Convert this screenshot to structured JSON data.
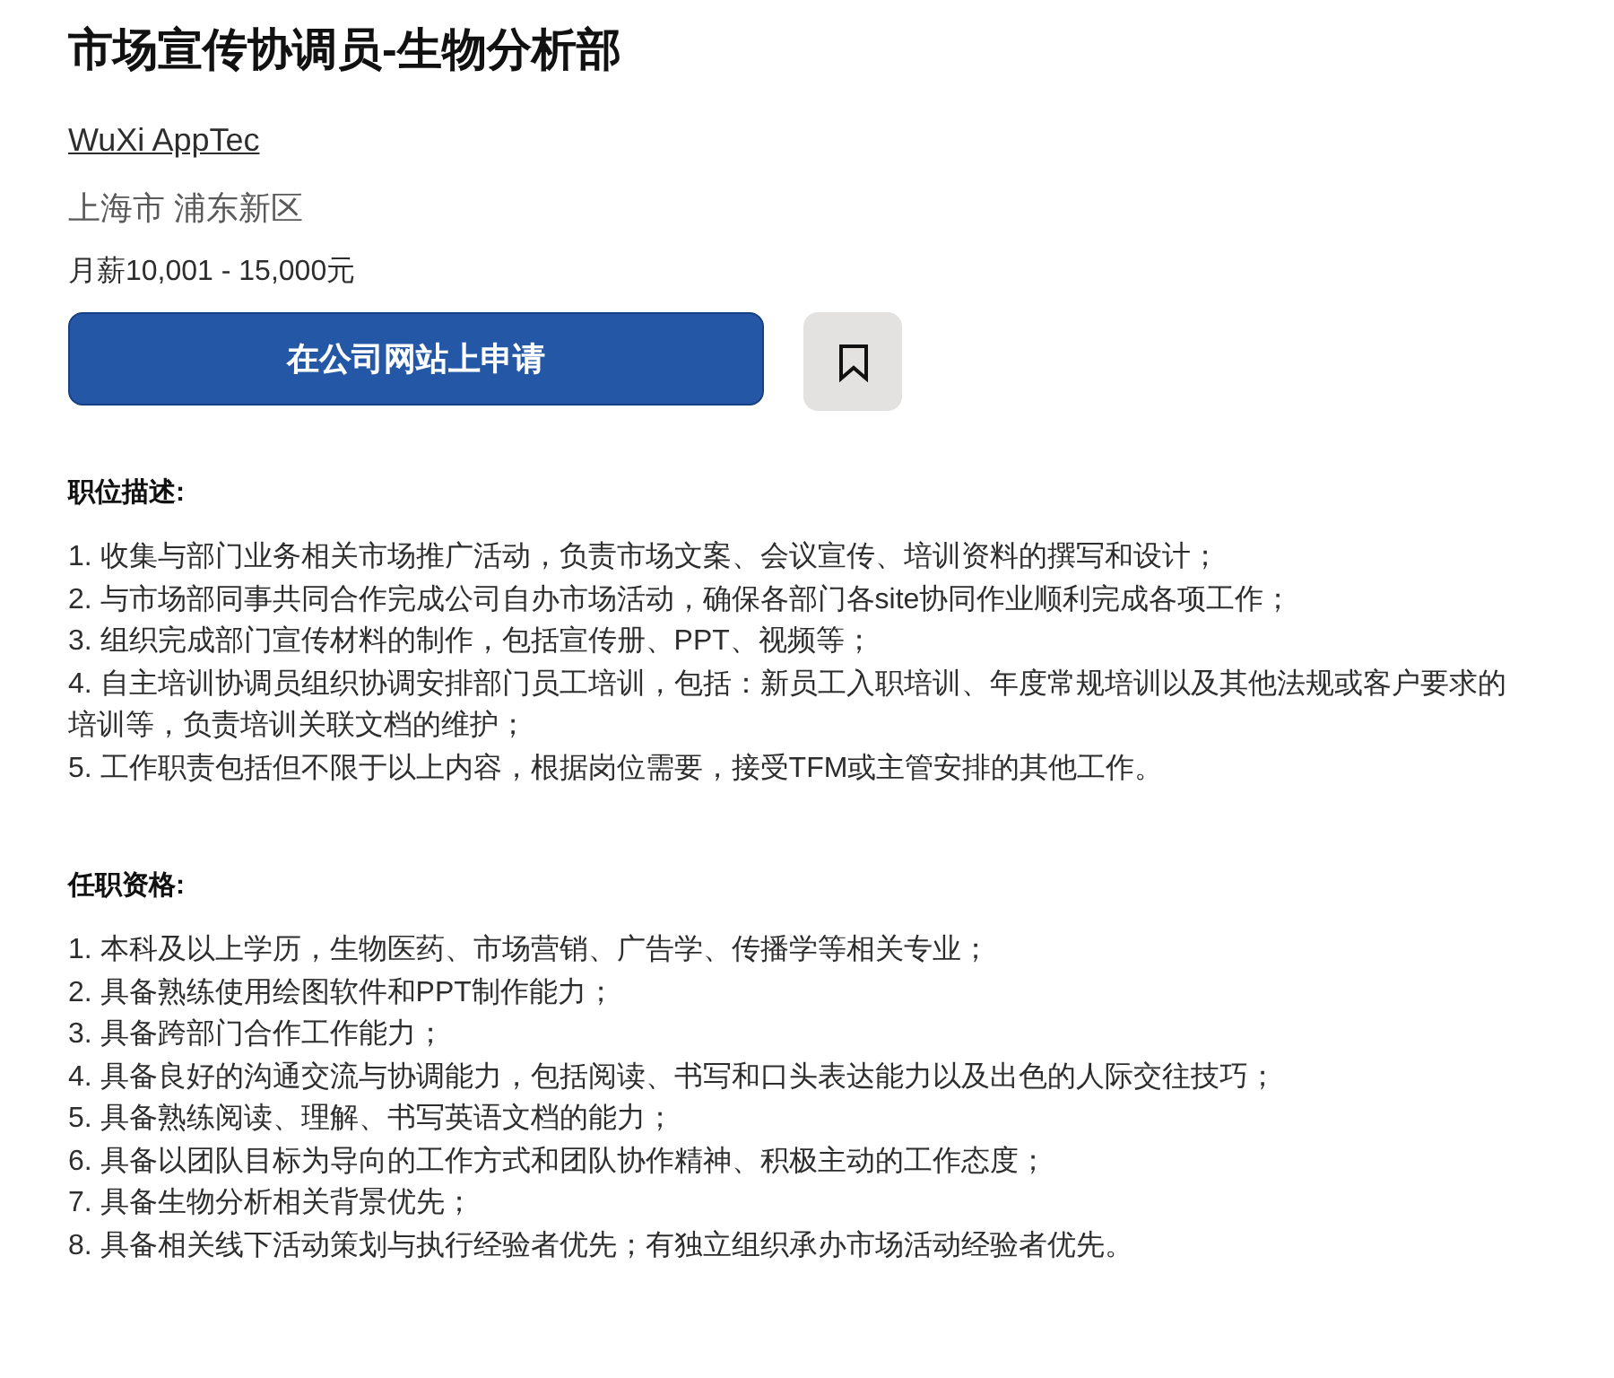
{
  "title": "市场宣传协调员-生物分析部",
  "company": "WuXi AppTec",
  "location": "上海市 浦东新区",
  "salary": "月薪10,001 - 15,000元",
  "apply_button": "在公司网站上申请",
  "sections": [
    {
      "heading": "职位描述:",
      "items": [
        "1. 收集与部门业务相关市场推广活动，负责市场文案、会议宣传、培训资料的撰写和设计；",
        "2. 与市场部同事共同合作完成公司自办市场活动，确保各部门各site协同作业顺利完成各项工作；",
        "3. 组织完成部门宣传材料的制作，包括宣传册、PPT、视频等；",
        "4. 自主培训协调员组织协调安排部门员工培训，包括：新员工入职培训、年度常规培训以及其他法规或客户要求的培训等，负责培训关联文档的维护；",
        "5. 工作职责包括但不限于以上内容，根据岗位需要，接受TFM或主管安排的其他工作。"
      ]
    },
    {
      "heading": "任职资格:",
      "items": [
        "1. 本科及以上学历，生物医药、市场营销、广告学、传播学等相关专业；",
        "2. 具备熟练使用绘图软件和PPT制作能力；",
        "3. 具备跨部门合作工作能力；",
        "4. 具备良好的沟通交流与协调能力，包括阅读、书写和口头表达能力以及出色的人际交往技巧；",
        "5. 具备熟练阅读、理解、书写英语文档的能力；",
        "6. 具备以团队目标为导向的工作方式和团队协作精神、积极主动的工作态度；",
        "7. 具备生物分析相关背景优先；",
        "8. 具备相关线下活动策划与执行经验者优先；有独立组织承办市场活动经验者优先。"
      ]
    }
  ]
}
